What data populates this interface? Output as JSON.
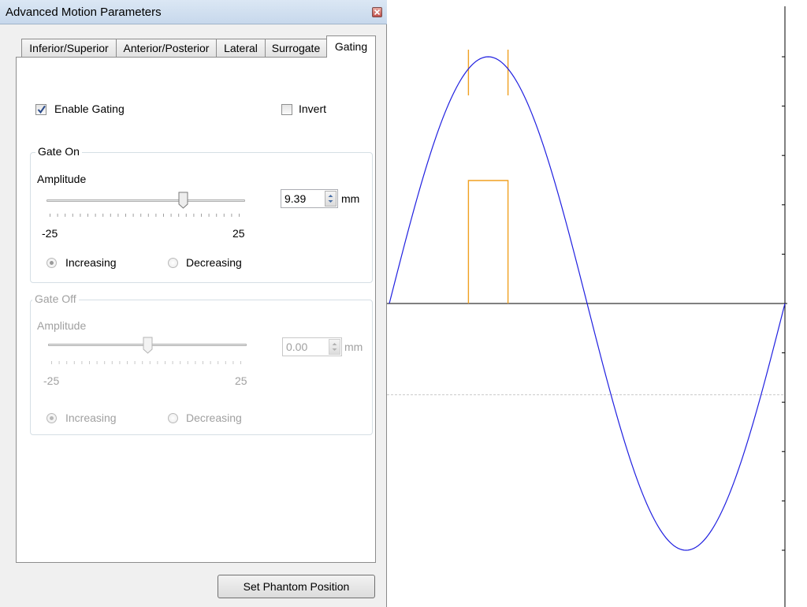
{
  "window": {
    "title": "Advanced Motion Parameters",
    "close_icon": "close-icon"
  },
  "tabs": [
    {
      "label": "Inferior/Superior",
      "active": false
    },
    {
      "label": "Anterior/Posterior",
      "active": false
    },
    {
      "label": "Lateral",
      "active": false
    },
    {
      "label": "Surrogate",
      "active": false
    },
    {
      "label": "Gating",
      "active": true
    }
  ],
  "gating": {
    "enable_label": "Enable Gating",
    "enable_checked": true,
    "invert_label": "Invert",
    "invert_checked": false
  },
  "gate_on": {
    "title": "Gate On",
    "amplitude_label": "Amplitude",
    "min_label": "-25",
    "max_label": "25",
    "slider_value": 9.39,
    "slider_min": -25,
    "slider_max": 25,
    "value": "9.39",
    "unit": "mm",
    "increasing_label": "Increasing",
    "decreasing_label": "Decreasing",
    "selected_direction": "Increasing"
  },
  "gate_off": {
    "title": "Gate Off",
    "enabled": false,
    "amplitude_label": "Amplitude",
    "min_label": "-25",
    "max_label": "25",
    "slider_value": 0.0,
    "slider_min": -25,
    "slider_max": 25,
    "value": "0.00",
    "unit": "mm",
    "increasing_label": "Increasing",
    "decreasing_label": "Decreasing",
    "selected_direction": "Increasing"
  },
  "buttons": {
    "set_phantom_position": "Set Phantom Position"
  },
  "colors": {
    "waveform": "#2020e0",
    "gate": "#f0a020",
    "axis": "#000000",
    "threshold": "#c8c8c8"
  },
  "chart_data": {
    "type": "line",
    "title": "",
    "xlabel": "",
    "ylabel": "",
    "series": [
      {
        "values": [
          0,
          0.5,
          0.866,
          1,
          0.866,
          0.5,
          0,
          -0.5,
          -0.866,
          -1,
          -0.866,
          -0.5,
          0
        ]
      }
    ],
    "gate_window": {
      "start_phase": 0.2,
      "end_phase": 0.3
    },
    "threshold_line": -0.37
  }
}
